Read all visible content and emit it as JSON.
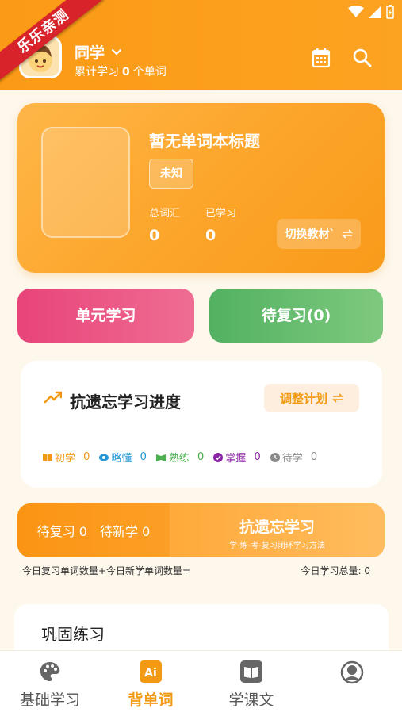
{
  "ribbon": "乐乐亲测",
  "header": {
    "user_name": "同学",
    "stats_prefix": "累计学习",
    "word_count": "0",
    "stats_suffix": "个单词"
  },
  "book": {
    "title": "暂无单词本标题",
    "tag": "未知",
    "total_label": "总词汇",
    "total_value": "0",
    "learned_label": "已学习",
    "learned_value": "0",
    "switch_label": "切换教材`"
  },
  "actions": {
    "unit_label": "单元学习",
    "review_label": "待复习(0)"
  },
  "progress": {
    "title": "抗遗忘学习进度",
    "plan_label": "调整计划",
    "legend": [
      {
        "label": "初学",
        "value": "0",
        "color": "#f39a14"
      },
      {
        "label": "略懂",
        "value": "0",
        "color": "#2196d6"
      },
      {
        "label": "熟练",
        "value": "0",
        "color": "#4caf50"
      },
      {
        "label": "掌握",
        "value": "0",
        "color": "#8e24aa"
      },
      {
        "label": "待学",
        "value": "0",
        "color": "#8a8a8a"
      }
    ]
  },
  "strip": {
    "review": "待复习 0",
    "new": "待新学 0",
    "title": "抗遗忘学习",
    "subtitle": "学-练-考-复习闭环学习方法"
  },
  "notes": {
    "left": "今日复习单词数量+今日新学单词数量=",
    "right": "今日学习总量: 0"
  },
  "practice": {
    "title": "巩固练习"
  },
  "tabs": [
    {
      "label": "基础学习"
    },
    {
      "label": "背单词"
    },
    {
      "label": "学课文"
    },
    {
      "label": ""
    }
  ],
  "colors": {
    "accent": "#fb9a16",
    "pink": "#e8447a",
    "green": "#52b162"
  }
}
